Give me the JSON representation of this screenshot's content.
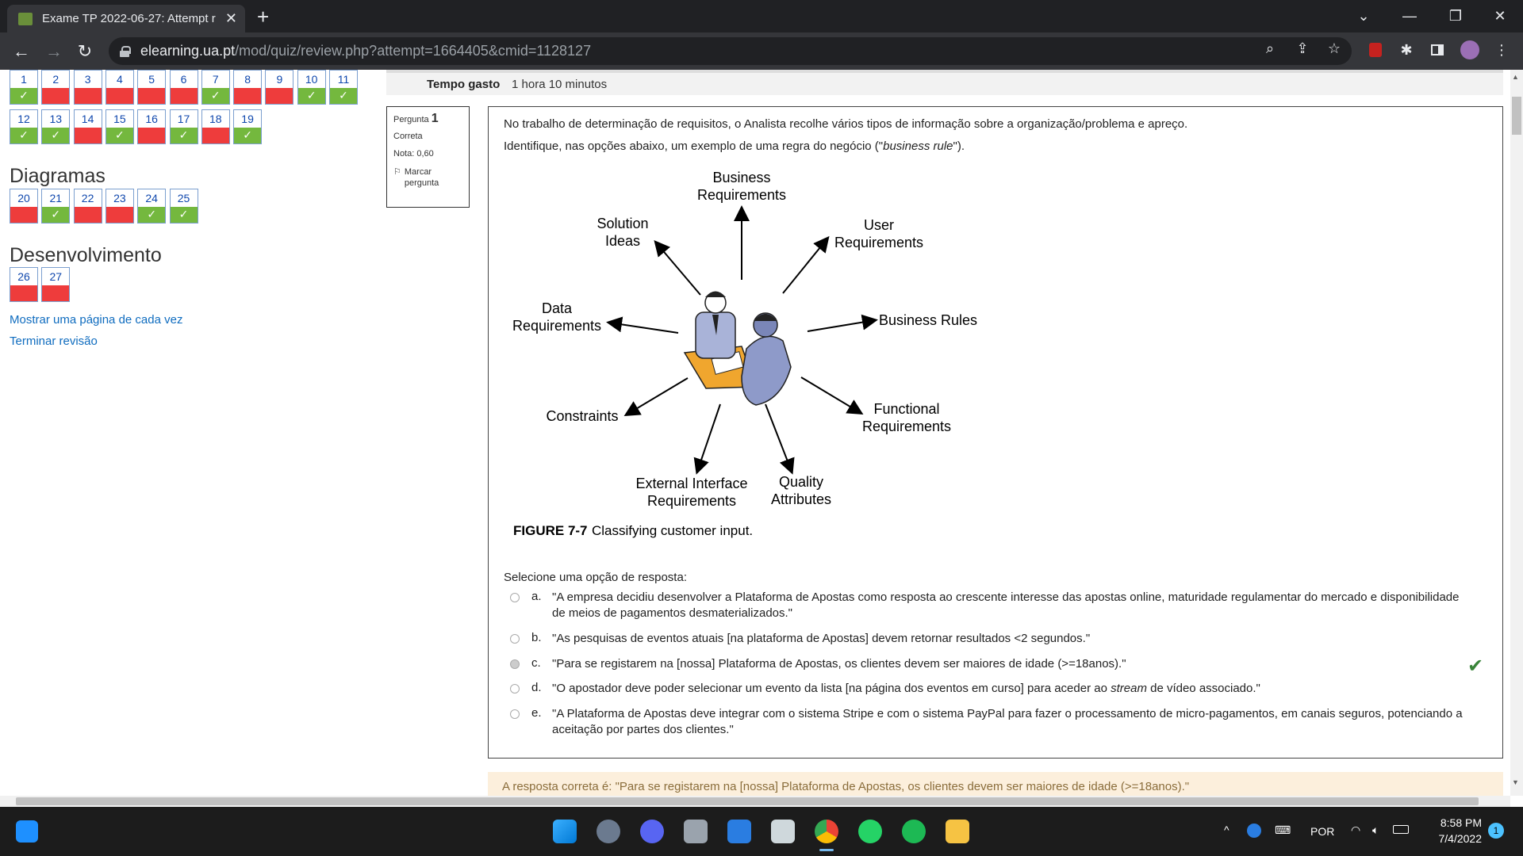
{
  "browser": {
    "tab_title": "Exame TP 2022-06-27: Attempt r",
    "url_host": "elearning.ua.pt",
    "url_path": "/mod/quiz/review.php?attempt=1664405&cmid=1128127"
  },
  "nav": {
    "row1": [
      {
        "n": "1",
        "s": "ok"
      },
      {
        "n": "2",
        "s": "bad"
      },
      {
        "n": "3",
        "s": "bad"
      },
      {
        "n": "4",
        "s": "bad"
      },
      {
        "n": "5",
        "s": "bad"
      },
      {
        "n": "6",
        "s": "bad"
      },
      {
        "n": "7",
        "s": "ok"
      },
      {
        "n": "8",
        "s": "bad"
      },
      {
        "n": "9",
        "s": "bad"
      },
      {
        "n": "10",
        "s": "ok"
      },
      {
        "n": "11",
        "s": "ok"
      }
    ],
    "row2": [
      {
        "n": "12",
        "s": "ok"
      },
      {
        "n": "13",
        "s": "ok"
      },
      {
        "n": "14",
        "s": "bad"
      },
      {
        "n": "15",
        "s": "ok"
      },
      {
        "n": "16",
        "s": "bad"
      },
      {
        "n": "17",
        "s": "ok"
      },
      {
        "n": "18",
        "s": "bad"
      },
      {
        "n": "19",
        "s": "ok"
      }
    ],
    "section_diagramas": "Diagramas",
    "row3": [
      {
        "n": "20",
        "s": "bad"
      },
      {
        "n": "21",
        "s": "ok"
      },
      {
        "n": "22",
        "s": "bad"
      },
      {
        "n": "23",
        "s": "bad"
      },
      {
        "n": "24",
        "s": "ok"
      },
      {
        "n": "25",
        "s": "ok"
      }
    ],
    "section_desenvolvimento": "Desenvolvimento",
    "row4": [
      {
        "n": "26",
        "s": "bad"
      },
      {
        "n": "27",
        "s": "bad"
      }
    ],
    "link_show_page": "Mostrar uma página de cada vez",
    "link_finish": "Terminar revisão"
  },
  "summary": {
    "time_label": "Tempo gasto",
    "time_value": "1 hora 10 minutos"
  },
  "question": {
    "label": "Pergunta",
    "number": "1",
    "state": "Correta",
    "grade": "Nota: 0,60",
    "flag": "Marcar pergunta",
    "text1": "No trabalho de determinação de requisitos, o Analista recolhe vários tipos de informação sobre a organização/problema e apreço.",
    "text2_a": "Identifique, nas opções abaixo, um exemplo de uma regra do negócio (\"",
    "text2_em": "business rule",
    "text2_b": "\").",
    "figure": {
      "labels": {
        "business_requirements": [
          "Business",
          "Requirements"
        ],
        "user_requirements": [
          "User",
          "Requirements"
        ],
        "solution_ideas": [
          "Solution",
          "Ideas"
        ],
        "data_requirements": [
          "Data",
          "Requirements"
        ],
        "business_rules": [
          "Business Rules"
        ],
        "constraints": [
          "Constraints"
        ],
        "functional_requirements": [
          "Functional",
          "Requirements"
        ],
        "external_interface": [
          "External Interface",
          "Requirements"
        ],
        "quality_attributes": [
          "Quality",
          "Attributes"
        ]
      },
      "caption_num": "FIGURE 7-7",
      "caption_text": "Classifying customer input."
    },
    "prompt": "Selecione uma opção de resposta:",
    "options": [
      {
        "l": "a.",
        "t": "\"A empresa decidiu desenvolver a Plataforma de Apostas como resposta ao crescente interesse das apostas online, maturidade regulamentar do mercado e disponibilidade de meios de pagamentos desmaterializados.\""
      },
      {
        "l": "b.",
        "t": "\"As pesquisas de eventos atuais [na plataforma de Apostas] devem retornar resultados <2 segundos.\""
      },
      {
        "l": "c.",
        "t": "\"Para se registarem na [nossa] Plataforma de Apostas, os clientes devem ser maiores de idade (>=18anos).\""
      },
      {
        "l": "d.",
        "t": "\"O apostador deve poder selecionar um evento da lista [na página dos  eventos em curso] para aceder ao stream de vídeo associado.\""
      },
      {
        "l": "e.",
        "t": "\"A Plataforma de Apostas deve integrar com o sistema Stripe e com o sistema PayPal para fazer o processamento de micro-pagamentos, em canais seguros, potenciando a aceitação por partes dos clientes.\""
      }
    ],
    "feedback": "A resposta correta é: \"Para se registarem na [nossa] Plataforma de Apostas, os clientes devem ser maiores de idade (>=18anos).\""
  },
  "taskbar": {
    "lang": "POR",
    "time": "8:58 PM",
    "date": "7/4/2022",
    "notif": "1"
  }
}
